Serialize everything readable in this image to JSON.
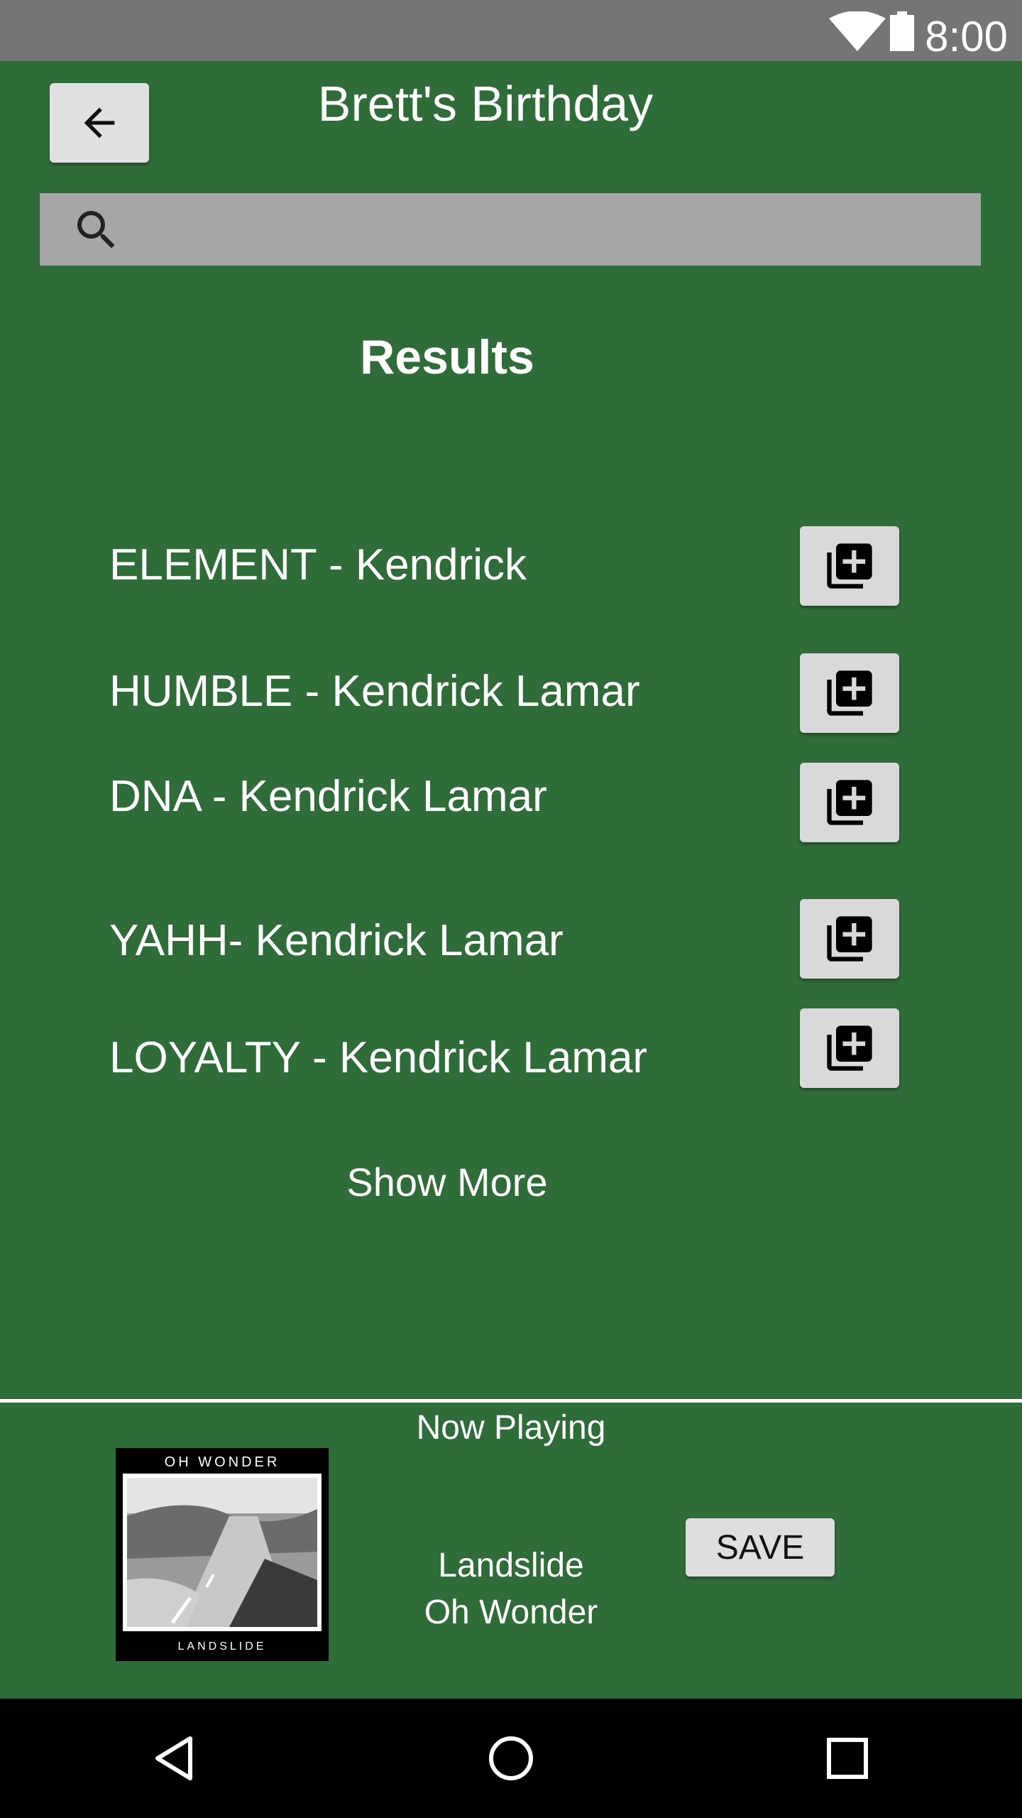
{
  "status_bar": {
    "time": "8:00"
  },
  "header": {
    "title": "Brett's Birthday"
  },
  "search": {
    "placeholder": "",
    "value": ""
  },
  "results": {
    "heading": "Results",
    "items": [
      {
        "label": "ELEMENT - Kendrick"
      },
      {
        "label": "HUMBLE - Kendrick Lamar"
      },
      {
        "label": "DNA - Kendrick Lamar"
      },
      {
        "label": "YAHH- Kendrick Lamar"
      },
      {
        "label": "LOYALTY - Kendrick Lamar"
      }
    ],
    "show_more_label": "Show More"
  },
  "now_playing": {
    "label": "Now Playing",
    "album_art_artist": "OH WONDER",
    "album_art_title": "LANDSLIDE",
    "track_title": "Landslide",
    "track_artist": "Oh Wonder",
    "save_label": "SAVE"
  },
  "icons": {
    "back": "arrow-left-icon",
    "search": "search-icon",
    "add": "add-to-queue-icon",
    "nav_back": "triangle-back-icon",
    "nav_home": "circle-home-icon",
    "nav_recents": "square-recents-icon"
  },
  "colors": {
    "background": "#306c3a",
    "status_bar": "#757575",
    "search_bar": "#a6a6a6",
    "button": "#d9d9d9",
    "nav_bar": "#000000"
  }
}
